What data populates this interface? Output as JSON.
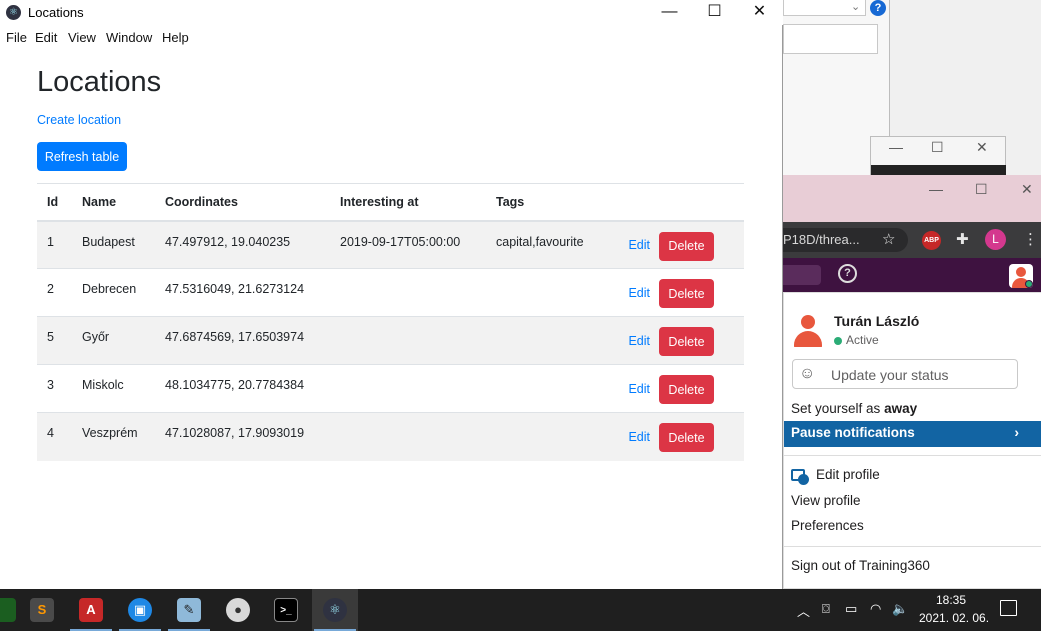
{
  "window": {
    "title": "Locations",
    "menu": [
      "File",
      "Edit",
      "View",
      "Window",
      "Help"
    ],
    "minimize_glyph": "—",
    "maximize_glyph": "☐",
    "close_glyph": "✕"
  },
  "page": {
    "title": "Locations",
    "create_link": "Create location",
    "refresh_button": "Refresh table"
  },
  "table": {
    "headers": [
      "Id",
      "Name",
      "Coordinates",
      "Interesting at",
      "Tags"
    ],
    "rows": [
      {
        "id": "1",
        "name": "Budapest",
        "coordinates": "47.497912, 19.040235",
        "interesting_at": "2019-09-17T05:00:00",
        "tags": "capital,favourite"
      },
      {
        "id": "2",
        "name": "Debrecen",
        "coordinates": "47.5316049, 21.6273124",
        "interesting_at": "",
        "tags": ""
      },
      {
        "id": "5",
        "name": "Győr",
        "coordinates": "47.6874569, 17.6503974",
        "interesting_at": "",
        "tags": ""
      },
      {
        "id": "3",
        "name": "Miskolc",
        "coordinates": "48.1034775, 20.7784384",
        "interesting_at": "",
        "tags": ""
      },
      {
        "id": "4",
        "name": "Veszprém",
        "coordinates": "47.1028087, 17.9093019",
        "interesting_at": "",
        "tags": ""
      }
    ],
    "edit_label": "Edit",
    "delete_label": "Delete"
  },
  "browser": {
    "url_fragment": "P18D/threa...",
    "abp_badge": "ABP",
    "profile_initial": "L",
    "help_glyph": "?"
  },
  "slack_menu": {
    "user_name": "Turán László",
    "status": "Active",
    "status_placeholder": "Update your status",
    "set_away_prefix": "Set yourself as",
    "set_away_word": "away",
    "pause_notifications": "Pause notifications",
    "edit_profile": "Edit profile",
    "view_profile": "View profile",
    "preferences": "Preferences",
    "sign_out": "Sign out of Training360"
  },
  "taskbar": {
    "time": "18:35",
    "date": "2021. 02. 06."
  },
  "colors": {
    "primary": "#007bff",
    "danger": "#dc3545",
    "slack_aubergine": "#3e1240",
    "slack_highlight": "#1264a3",
    "active_green": "#2bac76"
  }
}
